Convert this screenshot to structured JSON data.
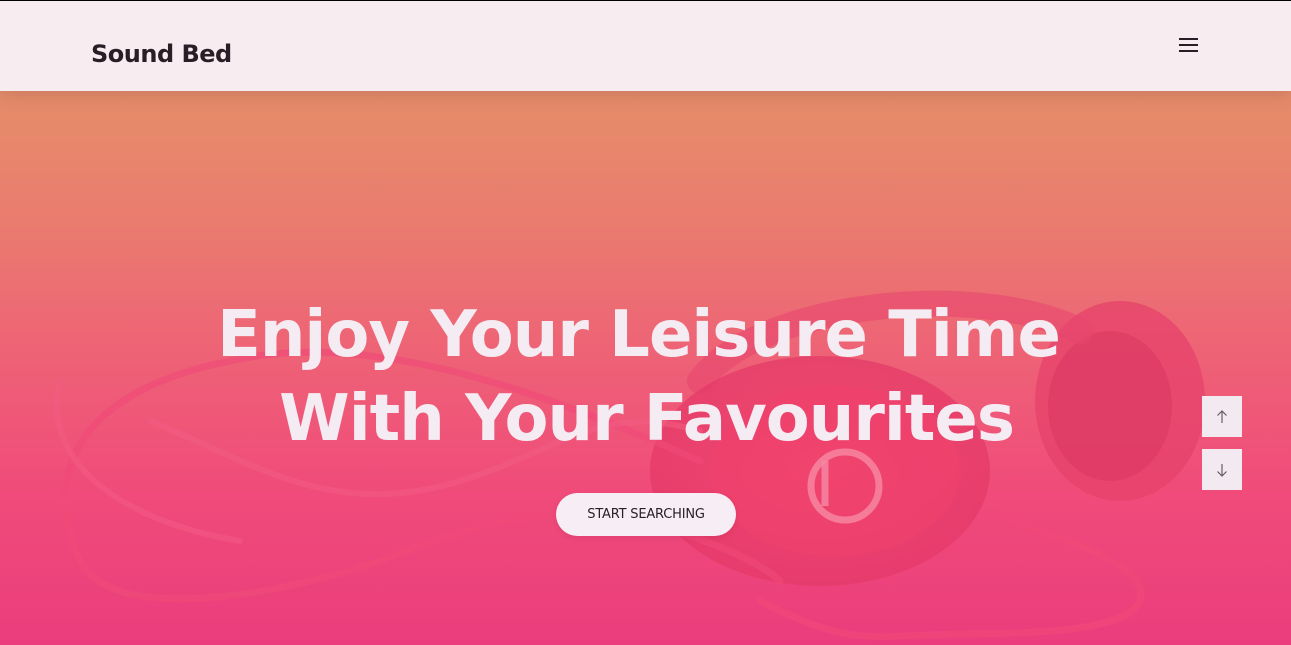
{
  "header": {
    "logo": "Sound Bed",
    "menu_icon": "hamburger-menu-icon"
  },
  "hero": {
    "headline_line1": "Enjoy Your Leisure Time",
    "headline_line2": "With Your Favourites",
    "cta_label": "START SEARCHING",
    "background_image": "pink-headphones-photo"
  },
  "scroll_controls": {
    "up_icon": "arrow-up-icon",
    "down_icon": "arrow-down-icon"
  },
  "colors": {
    "overlay_top": "#d9906e",
    "overlay_bottom": "#ea3d7d",
    "text_light": "#f5ecf3",
    "text_dark": "#2a1d26",
    "header_bg": "#f8f0f6"
  }
}
